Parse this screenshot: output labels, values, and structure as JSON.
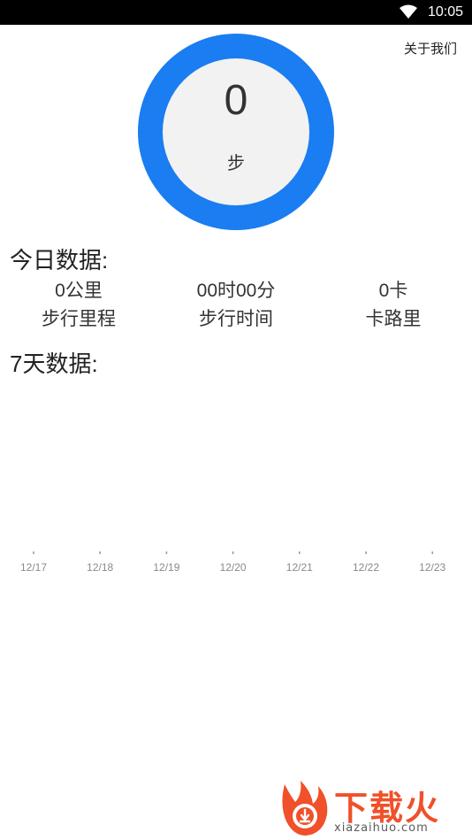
{
  "status_bar": {
    "time": "10:05"
  },
  "header": {
    "about_label": "关于我们"
  },
  "step_ring": {
    "value": "0",
    "unit": "步",
    "ring_color": "#1a7df1"
  },
  "today": {
    "title": "今日数据:",
    "stats": [
      {
        "value": "0公里",
        "label": "步行里程"
      },
      {
        "value": "00时00分",
        "label": "步行时间"
      },
      {
        "value": "0卡",
        "label": "卡路里"
      }
    ]
  },
  "week": {
    "title": "7天数据:"
  },
  "chart_data": {
    "type": "bar",
    "categories": [
      "12/17",
      "12/18",
      "12/19",
      "12/20",
      "12/21",
      "12/22",
      "12/23"
    ],
    "values": [
      0,
      0,
      0,
      0,
      0,
      0,
      0
    ],
    "title": "",
    "xlabel": "",
    "ylabel": "",
    "grid": false
  },
  "watermark": {
    "brand": "下载火",
    "url": "xiazaihuo.com",
    "color": "#f0502a"
  }
}
